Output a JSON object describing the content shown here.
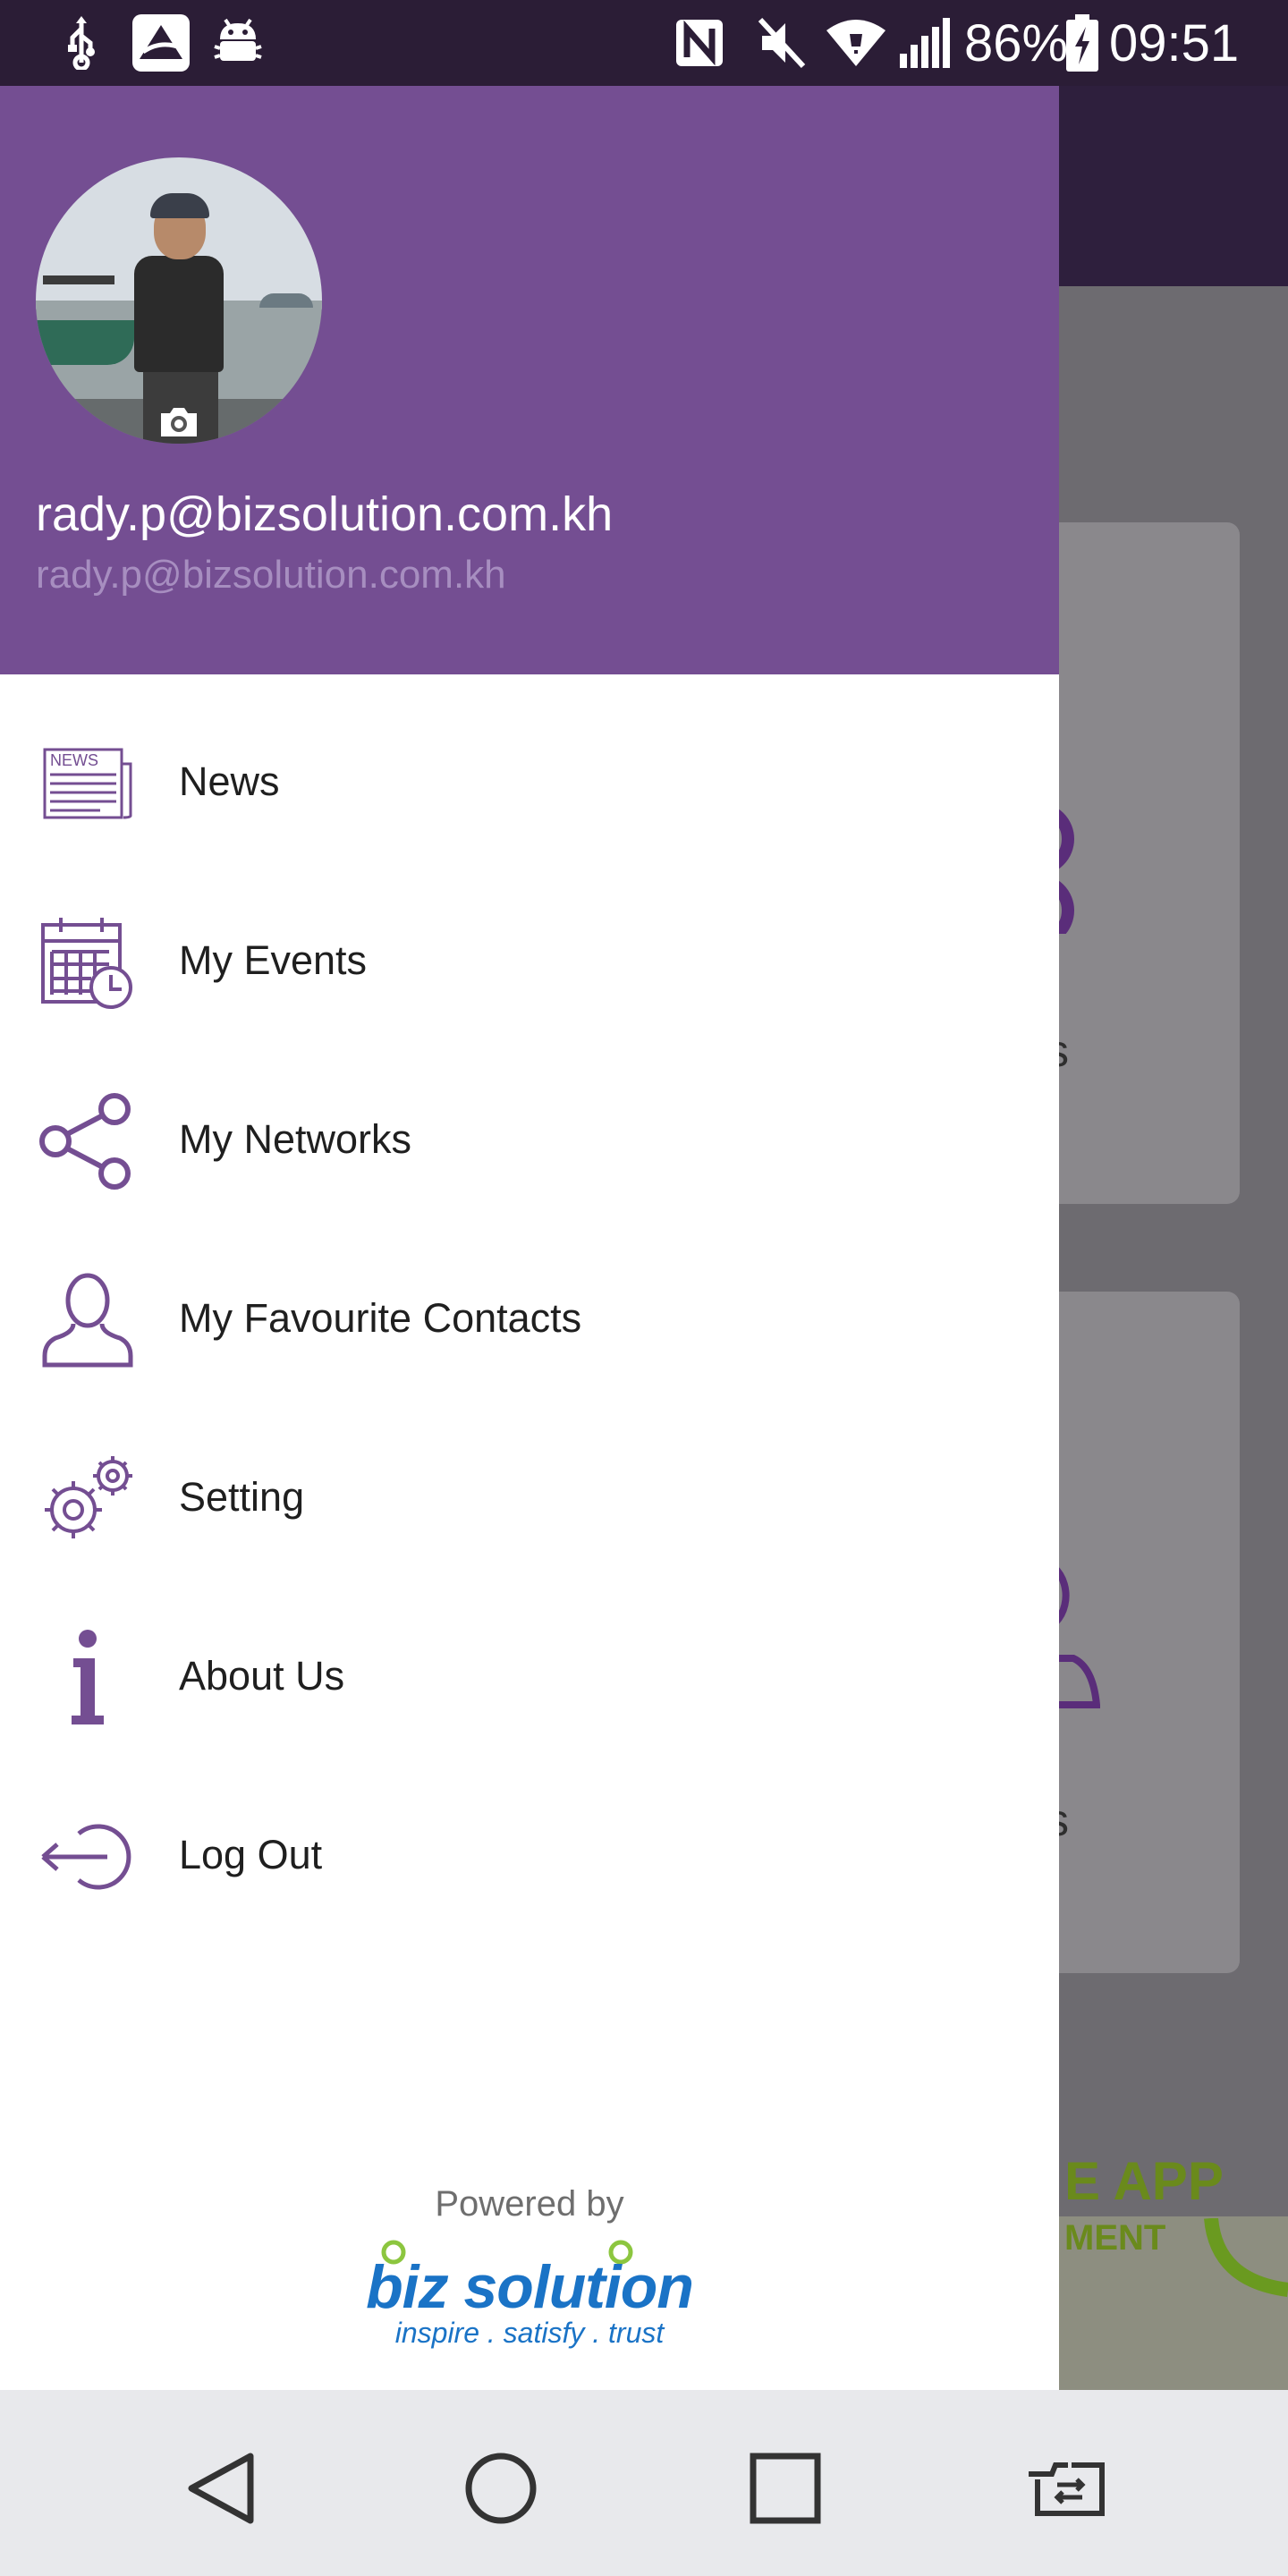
{
  "status_bar": {
    "battery": "86%",
    "time": "09:51",
    "icons": [
      "usb-icon",
      "app-notification-icon",
      "android-debug-icon",
      "nfc-icon",
      "mute-icon",
      "wifi-icon",
      "signal-icon",
      "battery-charging-icon"
    ]
  },
  "drawer": {
    "user_name": "rady.p@bizsolution.com.kh",
    "user_email": "rady.p@bizsolution.com.kh",
    "menu": [
      {
        "label": "News",
        "icon": "newspaper-icon"
      },
      {
        "label": "My Events",
        "icon": "calendar-clock-icon"
      },
      {
        "label": "My Networks",
        "icon": "share-network-icon"
      },
      {
        "label": "My Favourite Contacts",
        "icon": "person-icon"
      },
      {
        "label": "Setting",
        "icon": "gears-icon"
      },
      {
        "label": "About Us",
        "icon": "info-icon"
      },
      {
        "label": "Log Out",
        "icon": "logout-icon"
      }
    ],
    "powered_by": "Powered by",
    "logo_name": "biz solution",
    "logo_tagline": "inspire . satisfy . trust",
    "news_icon_text": "NEWS"
  },
  "background": {
    "banner_line1": "E APP",
    "banner_line2": "MENT",
    "card_fragment_1": "s",
    "card_fragment_2": "s"
  },
  "nav_bar": {
    "buttons": [
      "back-icon",
      "home-icon",
      "recents-icon",
      "switch-app-icon"
    ]
  },
  "colors": {
    "header_purple": "#744e92",
    "icon_purple": "#744e92",
    "status_bar": "#2b1d36",
    "logo_blue": "#1a73c6",
    "logo_green": "#8cc63f"
  }
}
